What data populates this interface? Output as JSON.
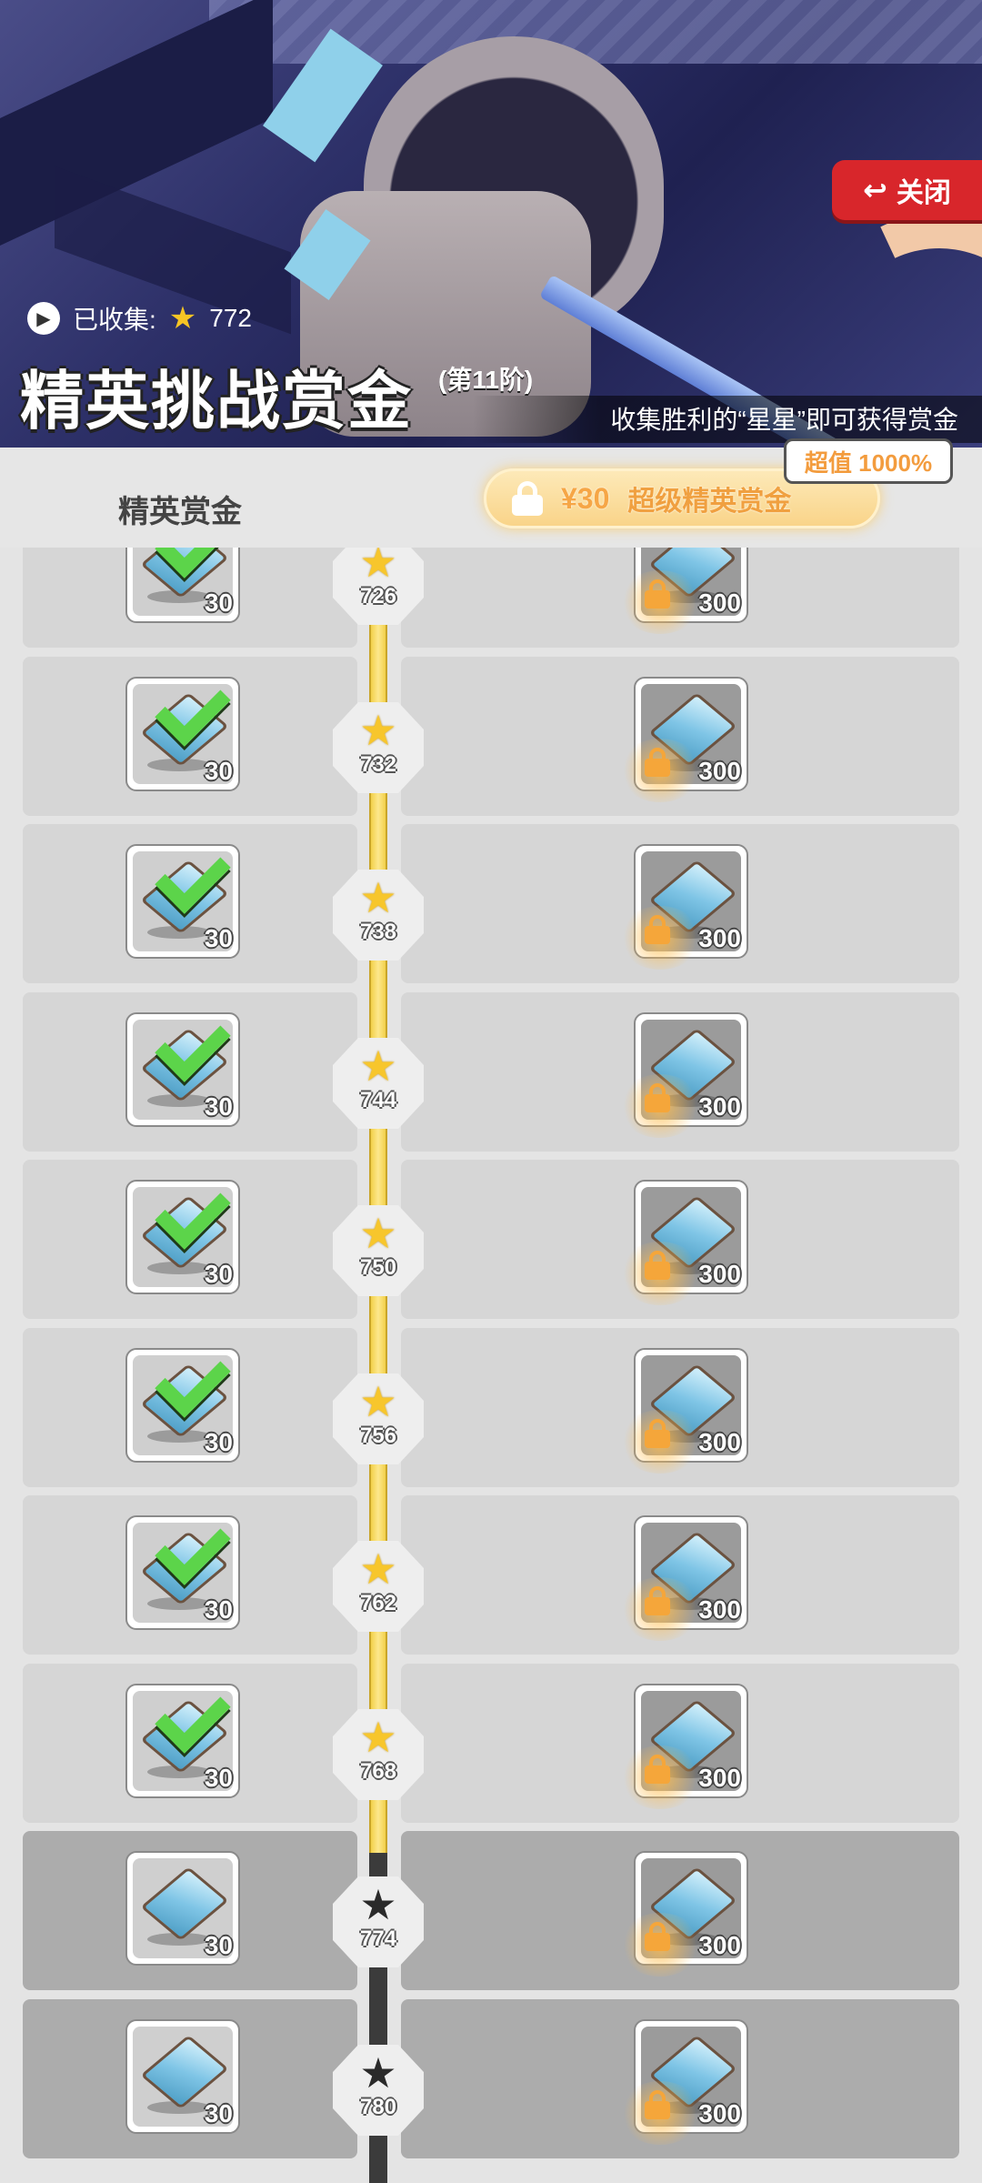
{
  "header": {
    "close_label": "关闭",
    "collected_label": "已收集:",
    "collected_stars": "772",
    "title": "精英挑战赏金",
    "tier": "(第11阶)",
    "description": "收集胜利的“星星”即可获得赏金"
  },
  "columns": {
    "free_title": "精英赏金",
    "premium_price": "¥30",
    "premium_title": "超级精英赏金",
    "premium_badge": "超值 1000%"
  },
  "rewards": [
    {
      "stars": "726",
      "free_qty": "30",
      "premium_qty": "300",
      "claimed": true
    },
    {
      "stars": "732",
      "free_qty": "30",
      "premium_qty": "300",
      "claimed": true
    },
    {
      "stars": "738",
      "free_qty": "30",
      "premium_qty": "300",
      "claimed": true
    },
    {
      "stars": "744",
      "free_qty": "30",
      "premium_qty": "300",
      "claimed": true
    },
    {
      "stars": "750",
      "free_qty": "30",
      "premium_qty": "300",
      "claimed": true
    },
    {
      "stars": "756",
      "free_qty": "30",
      "premium_qty": "300",
      "claimed": true
    },
    {
      "stars": "762",
      "free_qty": "30",
      "premium_qty": "300",
      "claimed": true
    },
    {
      "stars": "768",
      "free_qty": "30",
      "premium_qty": "300",
      "claimed": true
    },
    {
      "stars": "774",
      "free_qty": "30",
      "premium_qty": "300",
      "claimed": false
    },
    {
      "stars": "780",
      "free_qty": "30",
      "premium_qty": "300",
      "claimed": false
    }
  ],
  "icons": {
    "reward_item": "blue-gem-icon",
    "claimed_mark": "checkmark-icon",
    "locked_mark": "lock-icon",
    "track_node": "star-icon"
  },
  "colors": {
    "close_button": "#d8262b",
    "premium_accent": "#f6a646",
    "star_gold": "#f7c62c",
    "check_green": "#5cd44a"
  }
}
